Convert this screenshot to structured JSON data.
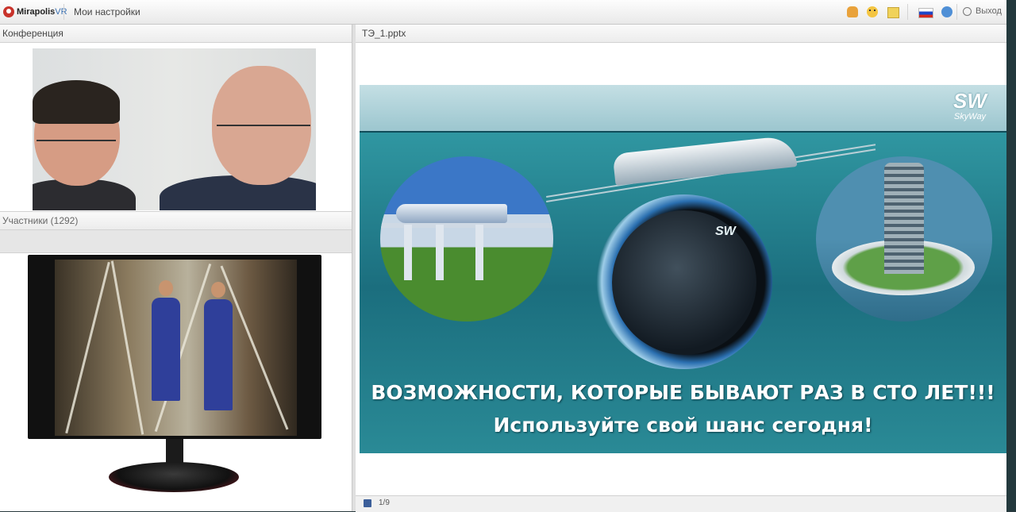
{
  "topbar": {
    "logo_text_bold": "Mirapolis",
    "logo_text_light": "VR",
    "settings_label": "Мои настройки",
    "exit_label": "Выход",
    "icons": [
      "hand-icon",
      "smile-icon",
      "note-icon",
      "flag-icon",
      "help-icon",
      "power-icon"
    ]
  },
  "conference": {
    "title": "Конференция"
  },
  "participants": {
    "title": "Участники (1292)"
  },
  "presentation": {
    "file_name": "ТЭ_1.pptx",
    "slide": {
      "logo_big": "SW",
      "logo_small": "SkyWay",
      "globe_logo": "SW",
      "title": "ВОЗМОЖНОСТИ, КОТОРЫЕ БЫВАЮТ РАЗ В СТО ЛЕТ!!!",
      "subtitle": "Используйте свой шанс сегодня!"
    },
    "page_indicator": "1/9"
  }
}
